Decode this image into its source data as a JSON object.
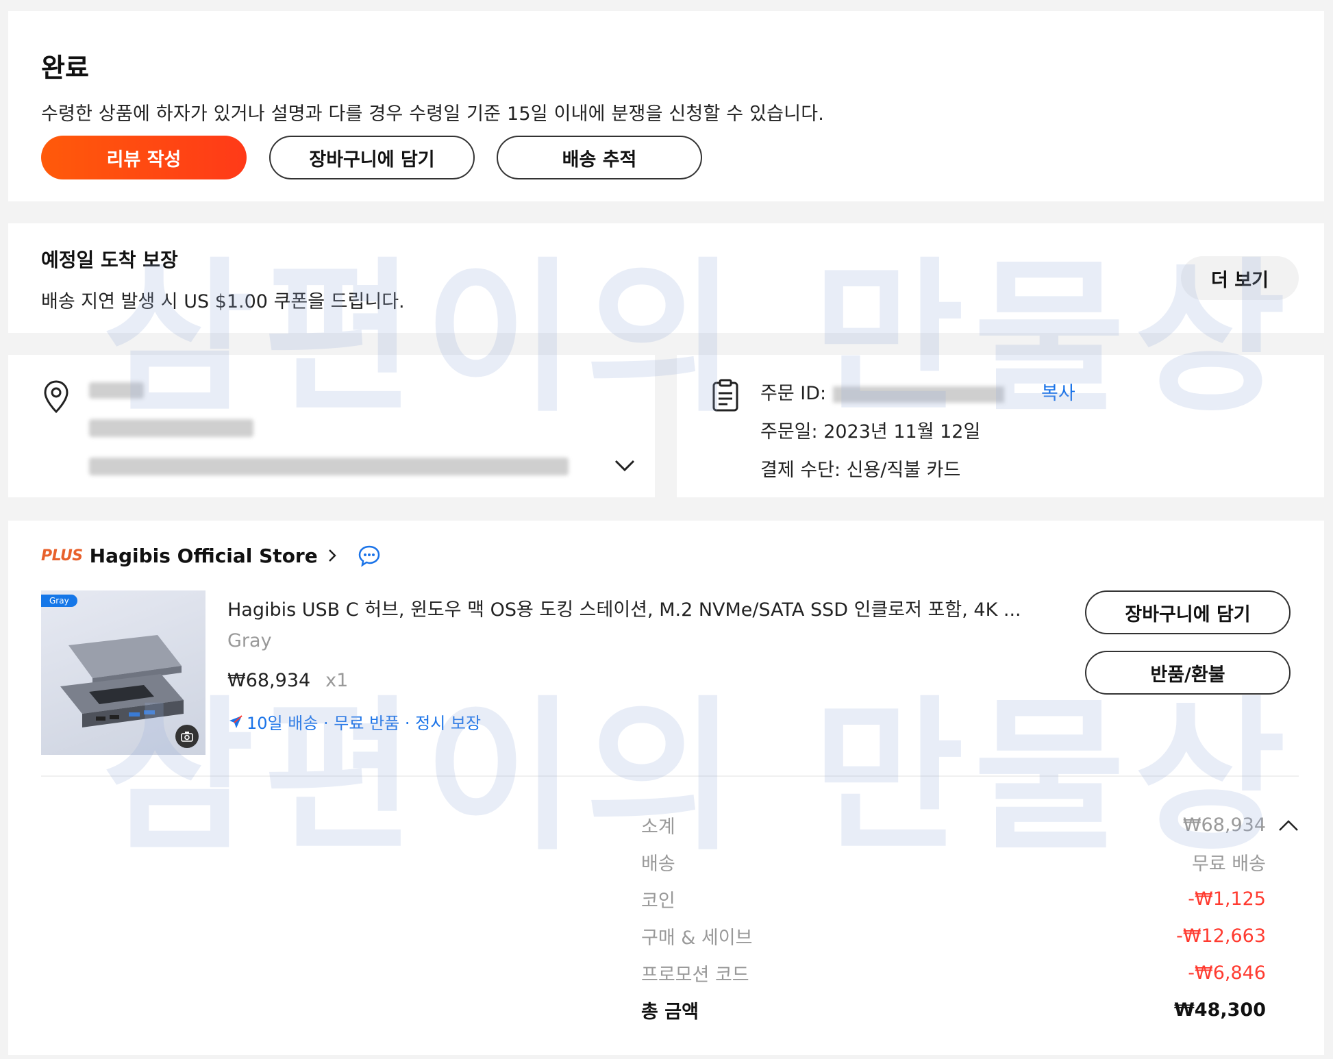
{
  "status": {
    "title": "완료",
    "description": "수령한 상품에 하자가 있거나 설명과 다를 경우 수령일 기준 15일 이내에 분쟁을 신청할 수 있습니다.",
    "review_label": "리뷰 작성",
    "add_cart_label": "장바구니에 담기",
    "track_label": "배송 추적"
  },
  "guarantee": {
    "title": "예정일 도착 보장",
    "description": "배송 지연 발생 시 US $1.00 쿠폰을 드립니다.",
    "more_label": "더 보기"
  },
  "order": {
    "id_label": "주문 ID:",
    "copy_label": "복사",
    "date_line": "주문일: 2023년 11월 12일",
    "payment_line": "결제 수단: 신용/직불 카드"
  },
  "store": {
    "badge": "PLUS",
    "name": "Hagibis Official Store"
  },
  "product": {
    "image_tag": "Gray",
    "title": "Hagibis USB C 허브, 윈도우 맥 OS용 도킹 스테이션, M.2 NVMe/SATA SSD 인클로저 포함, 4K ...",
    "variant": "Gray",
    "price": "₩68,934",
    "quantity": "x1",
    "perks": "10일 배송 · 무료 반품 · 정시 보장",
    "add_cart_label": "장바구니에 담기",
    "refund_label": "반품/환불"
  },
  "summary": {
    "subtotal_label": "소계",
    "subtotal_value": "₩68,934",
    "shipping_label": "배송",
    "shipping_value": "무료 배송",
    "coins_label": "코인",
    "coins_value": "-₩1,125",
    "bundle_label": "구매 & 세이브",
    "bundle_value": "-₩12,663",
    "promo_label": "프로모션 코드",
    "promo_value": "-₩6,846",
    "total_label": "총 금액",
    "total_value": "₩48,300"
  },
  "watermark": "삼편이의 만물상",
  "colors": {
    "primary_button": "#ff4f12",
    "link_blue": "#1a73e8",
    "discount_red": "#ff3b30"
  }
}
